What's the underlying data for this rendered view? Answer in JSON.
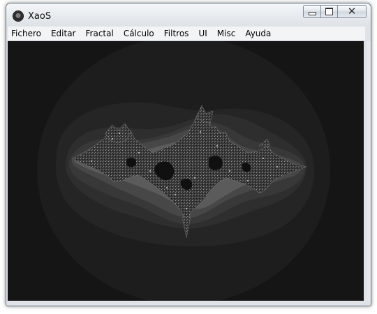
{
  "window": {
    "title": "XaoS"
  },
  "menu": {
    "items": [
      "Fichero",
      "Editar",
      "Fractal",
      "Cálculo",
      "Filtros",
      "UI",
      "Misc",
      "Ayuda"
    ]
  },
  "icons": {
    "app": "xaos-app-icon",
    "minimize": "minimize-icon",
    "maximize": "maximize-icon",
    "close": "close-icon"
  },
  "colors": {
    "background": "#151515",
    "fractal_body": "#3a3a3a"
  }
}
